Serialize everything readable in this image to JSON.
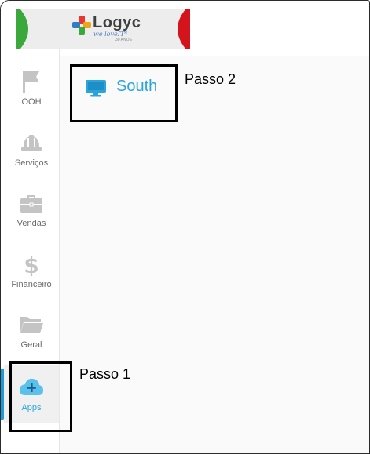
{
  "brand": {
    "logo_name": "Logyc",
    "logo_tagline": "we loveIT*",
    "logo_years": "30 ANOS"
  },
  "sidebar": {
    "items": [
      {
        "label": "OOH",
        "icon": "flag-icon"
      },
      {
        "label": "Serviços",
        "icon": "hardhat-icon"
      },
      {
        "label": "Vendas",
        "icon": "briefcase-icon"
      },
      {
        "label": "Financeiro",
        "icon": "dollar-icon"
      },
      {
        "label": "Geral",
        "icon": "folder-icon"
      },
      {
        "label": "Apps",
        "icon": "cloud-plus-icon",
        "active": true
      }
    ]
  },
  "main": {
    "apps": [
      {
        "label": "South",
        "icon": "monitor-icon"
      }
    ]
  },
  "annotations": {
    "step1": "Passo 1",
    "step2": "Passo 2"
  },
  "colors": {
    "accent": "#2aa4dc",
    "icon_gray": "#c4c4c4",
    "logo_green": "#3aa83a",
    "logo_red": "#d4141c"
  }
}
